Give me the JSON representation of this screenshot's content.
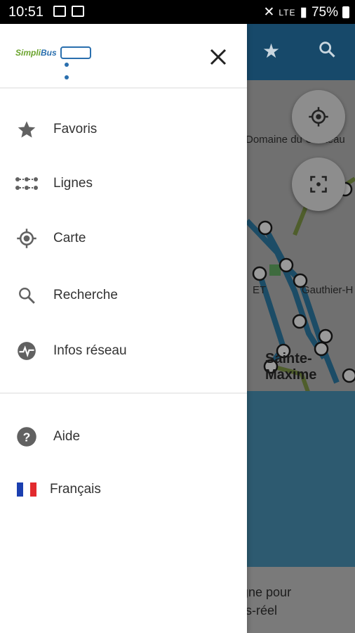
{
  "status_bar": {
    "time": "10:51",
    "battery": "75%",
    "network": "LTE"
  },
  "background_app": {
    "map_labels": {
      "domaine": "Domaine du Château",
      "gauthier": "Gauthier-H",
      "et": "ET",
      "city": "Sainte-Maxime"
    },
    "bottom_message": {
      "line1": "igne pour",
      "line2": "ps-réel"
    }
  },
  "drawer": {
    "logo": {
      "brand_green": "Simpli",
      "brand_blue": "Bus"
    },
    "menu": [
      {
        "label": "Favoris",
        "icon": "star-icon"
      },
      {
        "label": "Lignes",
        "icon": "lines-icon"
      },
      {
        "label": "Carte",
        "icon": "location-target-icon"
      },
      {
        "label": "Recherche",
        "icon": "search-icon"
      },
      {
        "label": "Infos réseau",
        "icon": "network-info-icon"
      }
    ],
    "secondary": [
      {
        "label": "Aide",
        "icon": "help-icon"
      },
      {
        "label": "Français",
        "icon": "france-flag-icon"
      }
    ]
  },
  "colors": {
    "appbar": "#17496a",
    "accent_blue": "#2a6fae",
    "accent_green": "#6aa32c",
    "flag_blue": "#1b3fb0",
    "flag_red": "#e22a2e"
  }
}
